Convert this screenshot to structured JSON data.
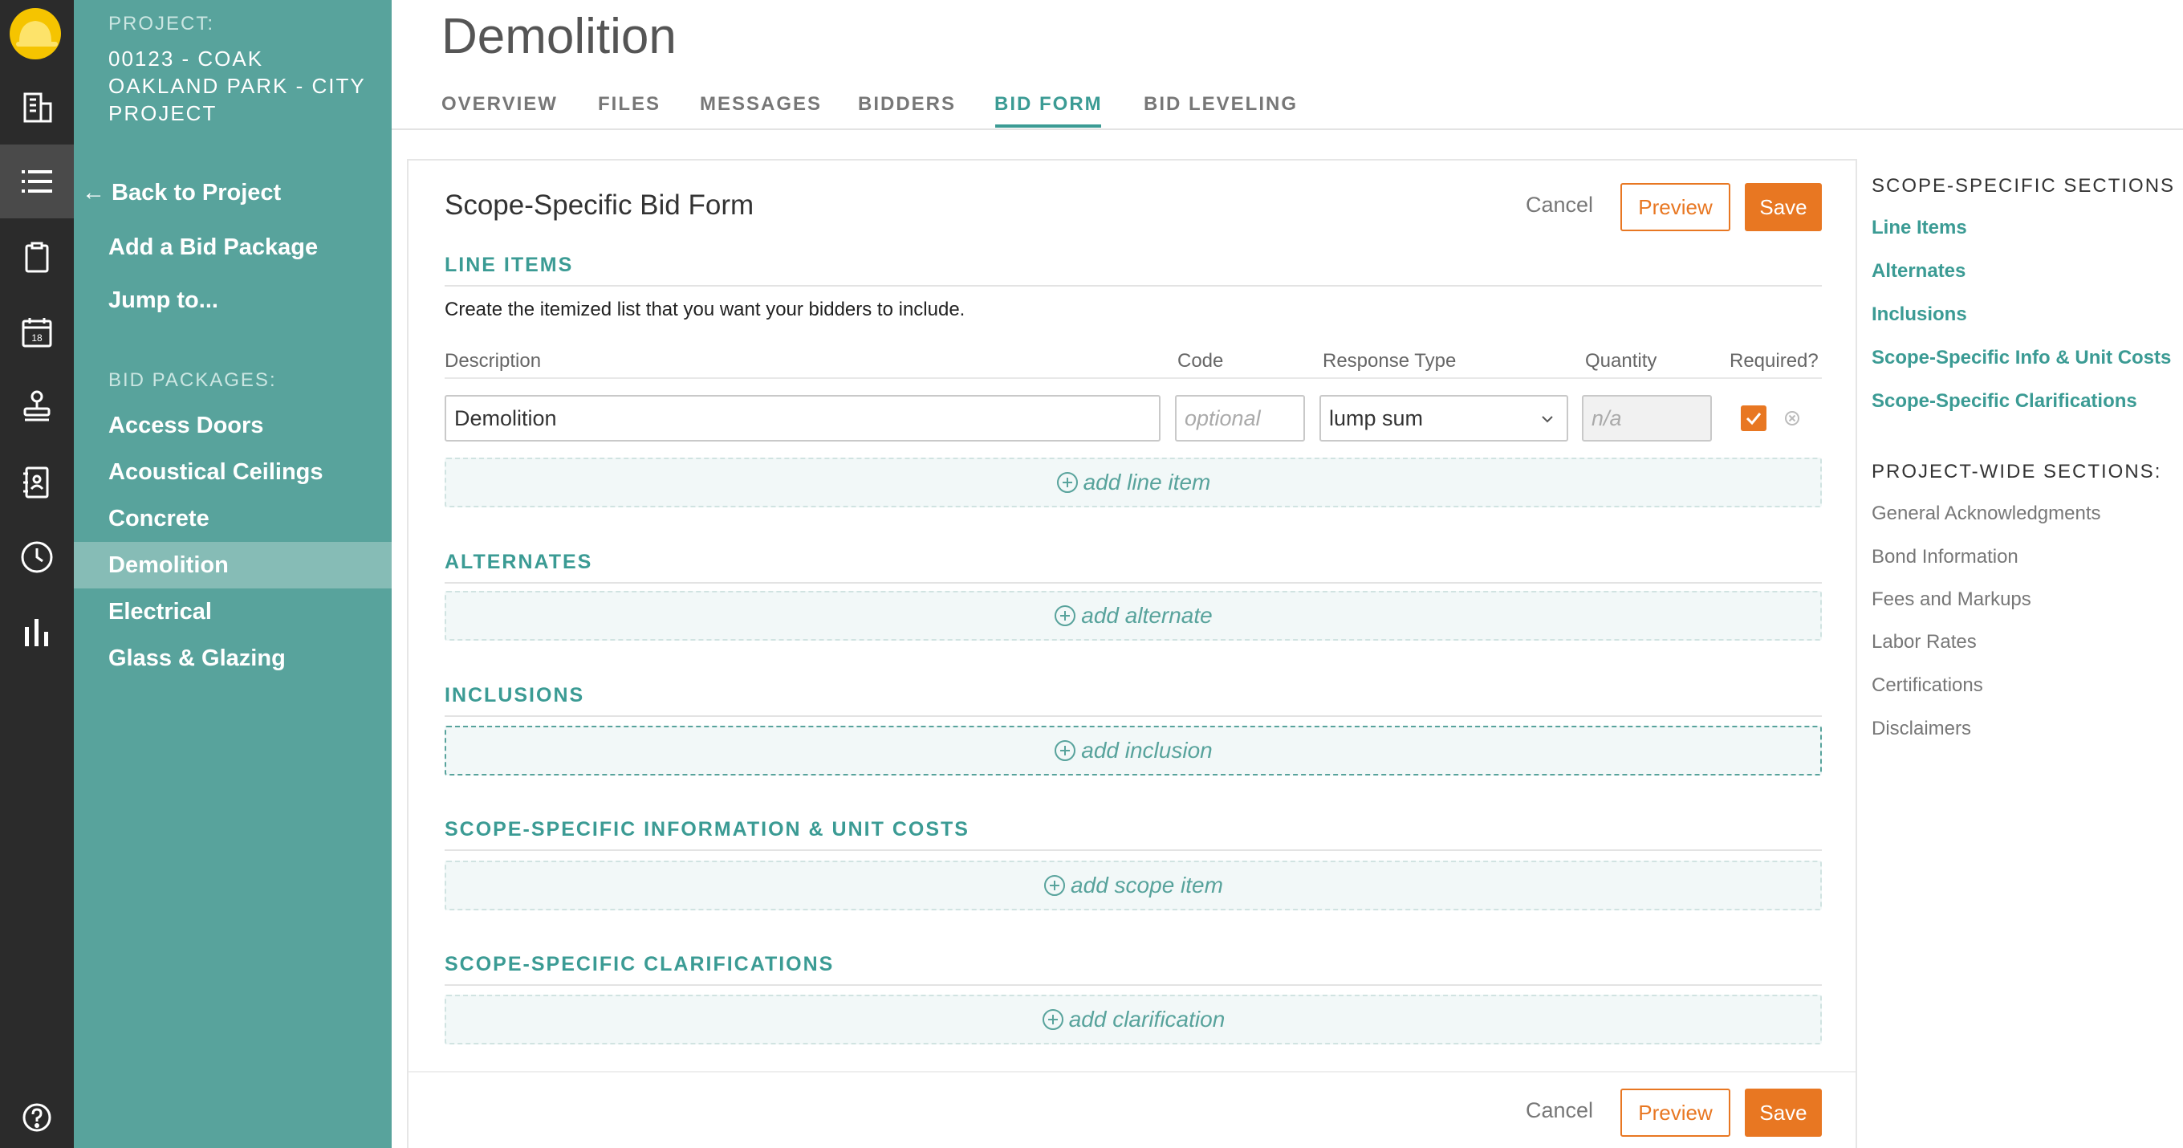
{
  "rail": {
    "icons": [
      "hardhat-logo-icon",
      "building-icon",
      "list-icon",
      "clipboard-icon",
      "calendar-icon",
      "stamp-icon",
      "address-book-icon",
      "clock-icon",
      "bar-chart-icon",
      "help-icon"
    ],
    "calendar_day": "18"
  },
  "sidebar": {
    "project_label": "PROJECT:",
    "project_name": "00123 - COAK OAKLAND PARK - CITY PROJECT",
    "back_label": "← Back to Project",
    "add_package_label": "Add a Bid Package",
    "jump_label": "Jump to...",
    "bid_packages_label": "BID PACKAGES:",
    "bid_packages": [
      "Access Doors",
      "Acoustical Ceilings",
      "Concrete",
      "Demolition",
      "Electrical",
      "Glass & Glazing"
    ],
    "active_package": "Demolition"
  },
  "header": {
    "title": "Demolition",
    "tabs": [
      "OVERVIEW",
      "FILES",
      "MESSAGES",
      "BIDDERS",
      "BID FORM",
      "BID LEVELING"
    ],
    "active_tab": "BID FORM"
  },
  "form": {
    "title": "Scope-Specific Bid Form",
    "cancel_label": "Cancel",
    "preview_label": "Preview",
    "save_label": "Save",
    "line_items": {
      "heading": "LINE ITEMS",
      "description": "Create the itemized list that you want your bidders to include.",
      "columns": [
        "Description",
        "Code",
        "Response Type",
        "Quantity",
        "Required?"
      ],
      "row": {
        "description": "Demolition",
        "code_placeholder": "optional",
        "response_type": "lump sum",
        "quantity_placeholder": "n/a",
        "required": true
      },
      "add_label": "add line item"
    },
    "alternates": {
      "heading": "ALTERNATES",
      "add_label": "add alternate"
    },
    "inclusions": {
      "heading": "INCLUSIONS",
      "add_label": "add inclusion"
    },
    "scope_info": {
      "heading": "SCOPE-SPECIFIC INFORMATION & UNIT COSTS",
      "add_label": "add scope item"
    },
    "clarifications": {
      "heading": "SCOPE-SPECIFIC CLARIFICATIONS",
      "add_label": "add clarification"
    }
  },
  "right_nav": {
    "scope_heading": "SCOPE-SPECIFIC SECTIONS",
    "scope_items": [
      "Line Items",
      "Alternates",
      "Inclusions",
      "Scope-Specific Info & Unit Costs",
      "Scope-Specific Clarifications"
    ],
    "project_heading": "PROJECT-WIDE SECTIONS:",
    "project_items": [
      "General Acknowledgments",
      "Bond Information",
      "Fees and Markups",
      "Labor Rates",
      "Certifications",
      "Disclaimers"
    ]
  },
  "colors": {
    "teal": "#3b9b94",
    "sidebar": "#58a39c",
    "orange": "#e87722",
    "rail": "#2b2b2b"
  }
}
